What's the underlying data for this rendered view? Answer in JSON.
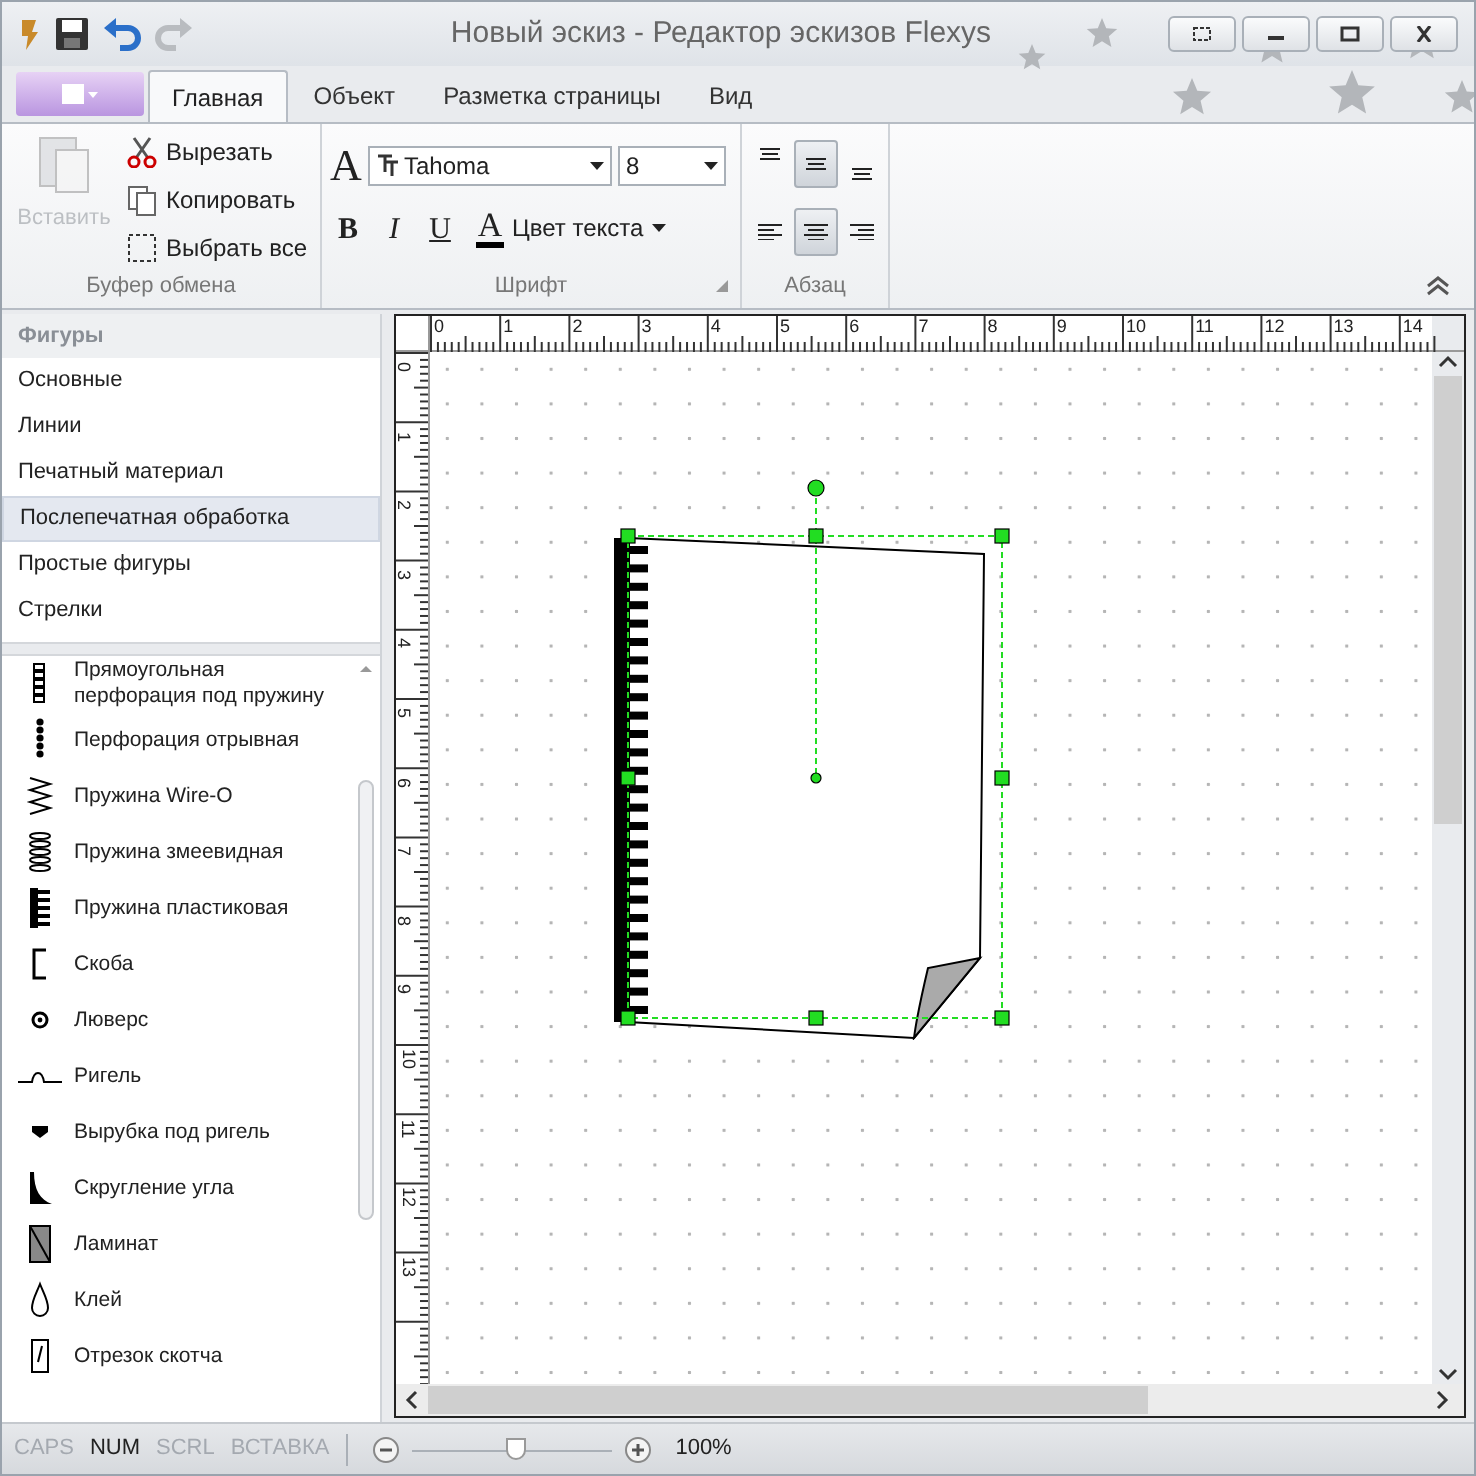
{
  "window": {
    "title": "Новый эскиз - Редактор эскизов Flexys"
  },
  "tabs": [
    {
      "label": "Главная",
      "selected": true
    },
    {
      "label": "Объект",
      "selected": false
    },
    {
      "label": "Разметка страницы",
      "selected": false
    },
    {
      "label": "Вид",
      "selected": false
    }
  ],
  "clipboard": {
    "label": "Буфер обмена",
    "paste": {
      "label": "Вставить",
      "disabled": true
    },
    "actions": [
      {
        "kind": "cut",
        "label": "Вырезать"
      },
      {
        "kind": "copy",
        "label": "Копировать"
      },
      {
        "kind": "select_all",
        "label": "Выбрать все"
      }
    ]
  },
  "font": {
    "label": "Шрифт",
    "grow_glyph": "A",
    "family": "Tahoma",
    "size": "8",
    "styles": [
      {
        "kind": "bold",
        "label": "B"
      },
      {
        "kind": "italic",
        "label": "I"
      },
      {
        "kind": "underline",
        "label": "U"
      }
    ],
    "color_glyph": "A",
    "color_label": "Цвет текста"
  },
  "paragraph": {
    "label": "Абзац",
    "vertical": [
      {
        "kind": "top",
        "selected": false
      },
      {
        "kind": "middle",
        "selected": true
      },
      {
        "kind": "bottom",
        "selected": false
      }
    ],
    "horizontal": [
      {
        "kind": "left",
        "selected": false
      },
      {
        "kind": "center",
        "selected": true
      },
      {
        "kind": "right",
        "selected": false
      }
    ]
  },
  "shapes": {
    "title": "Фигуры",
    "categories": [
      {
        "label": "Основные",
        "selected": false
      },
      {
        "label": "Линии",
        "selected": false
      },
      {
        "label": "Печатный материал",
        "selected": false
      },
      {
        "label": "Послепечатная обработка",
        "selected": true
      },
      {
        "label": "Простые фигуры",
        "selected": false
      },
      {
        "label": "Стрелки",
        "selected": false
      }
    ],
    "items": [
      {
        "kind": "rect_perforation",
        "label": "Прямоугольная перфорация под пружину"
      },
      {
        "kind": "tear_perforation",
        "label": "Перфорация отрывная"
      },
      {
        "kind": "wire",
        "label": "Пружина Wire-O"
      },
      {
        "kind": "coil",
        "label": "Пружина змеевидная"
      },
      {
        "kind": "plastic",
        "label": "Пружина пластиковая"
      },
      {
        "kind": "staple",
        "label": "Скоба"
      },
      {
        "kind": "eyelet",
        "label": "Люверс"
      },
      {
        "kind": "rigel",
        "label": "Ригель"
      },
      {
        "kind": "notch",
        "label": "Вырубка под ригель"
      },
      {
        "kind": "corner",
        "label": "Скругление угла"
      },
      {
        "kind": "laminate",
        "label": "Ламинат"
      },
      {
        "kind": "glue",
        "label": "Клей"
      },
      {
        "kind": "tape",
        "label": "Отрезок скотча"
      }
    ]
  },
  "rulers": {
    "x_labels": [
      "0",
      "1",
      "2",
      "3",
      "4",
      "5",
      "6",
      "7",
      "8",
      "9",
      "10",
      "11",
      "12",
      "13",
      "14"
    ],
    "y_labels": [
      "0",
      "1",
      "2",
      "3",
      "4",
      "5",
      "6",
      "7",
      "8",
      "9",
      "10",
      "11",
      "12",
      "13"
    ]
  },
  "status_bar": {
    "indicators": [
      {
        "label": "CAPS",
        "on": false
      },
      {
        "label": "NUM",
        "on": true
      },
      {
        "label": "SCRL",
        "on": false
      },
      {
        "label": "ВСТАВКА",
        "on": false
      }
    ],
    "zoom": {
      "level": 0.52,
      "reading": "100%"
    }
  }
}
